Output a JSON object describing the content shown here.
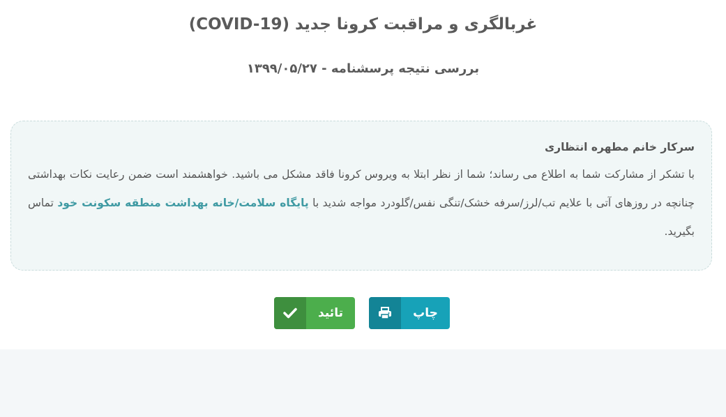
{
  "header": {
    "title": "غربالگری و مراقبت کرونا جدید (COVID-19)",
    "subtitle": "بررسی نتیجه پرسشنامه - ۱۳۹۹/۰۵/۲۷"
  },
  "result": {
    "greeting": "سرکار خانم مطهره انتظاری",
    "text_part1": "با تشکر از مشارکت شما به اطلاع می رساند؛ شما از نظر ابتلا به ویروس کرونا فاقد مشکل می باشید. خواهشمند است ضمن رعایت نکات بهداشتی چنانچه در روزهای آتی با علایم تب/لرز/سرفه خشک/تنگی نفس/گلودرد مواجه شدید با",
    "link_text": "پایگاه سلامت/خانه بهداشت منطقه سکونت خود",
    "text_part2": "تماس بگیرید."
  },
  "buttons": {
    "print_label": "چاپ",
    "print_icon": "printer-icon",
    "confirm_label": "تائید",
    "confirm_icon": "check-icon"
  },
  "colors": {
    "print_button": "#17a2b8",
    "confirm_button": "#4cae4c",
    "link": "#3f9aa3"
  }
}
